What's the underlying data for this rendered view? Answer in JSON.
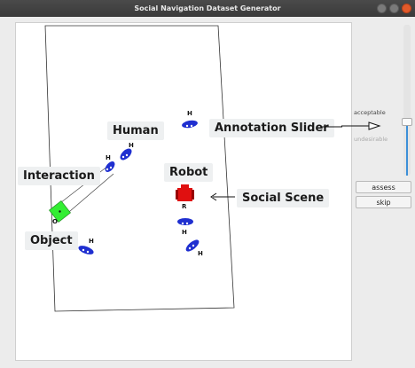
{
  "window": {
    "title": "Social Navigation Dataset Generator"
  },
  "scene": {
    "human_glyph": "H",
    "robot_glyph": "R",
    "object_glyph": "O"
  },
  "callouts": {
    "human": "Human",
    "interaction": "Interaction",
    "object": "Object",
    "robot": "Robot",
    "social_scene": "Social Scene",
    "annotation_slider": "Annotation Slider"
  },
  "slider": {
    "top_label": "acceptable",
    "bottom_label": "undesirable",
    "value_fraction": 0.34
  },
  "buttons": {
    "assess": "assess",
    "skip": "skip"
  },
  "colors": {
    "human": "#1f2fd0",
    "robot": "#e01010",
    "object": "#33ee33",
    "slider_fill": "#3c8fd8"
  },
  "icons": {
    "close": "close-icon",
    "minimize": "minimize-icon",
    "maximize": "maximize-icon"
  }
}
